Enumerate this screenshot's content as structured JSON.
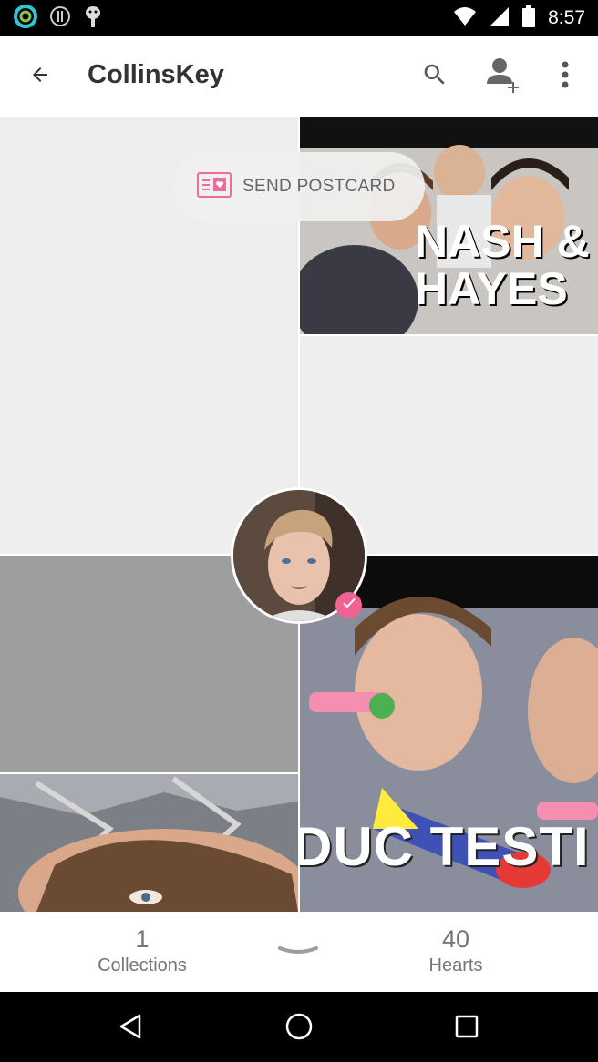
{
  "status_bar": {
    "time": "8:57",
    "icons": [
      "ring-app-icon",
      "info-icon",
      "android-debug-icon",
      "wifi-icon",
      "signal-icon",
      "battery-icon"
    ]
  },
  "app_bar": {
    "title": "CollinsKey",
    "actions": [
      "back-arrow-icon",
      "search-icon",
      "add-person-icon",
      "more-vert-icon"
    ]
  },
  "postcard": {
    "label": "SEND POSTCARD"
  },
  "photos": {
    "top_right_text": "NASH & HAYES",
    "bottom_right_text": "DUC TESTI"
  },
  "stats": {
    "collections_count": "1",
    "collections_label": "Collections",
    "hearts_count": "40",
    "hearts_label": "Hearts"
  },
  "colors": {
    "accent_pink": "#f06292",
    "text_gray": "#757575",
    "tile_empty": "#eeeeee",
    "tile_gray": "#9e9e9e"
  }
}
